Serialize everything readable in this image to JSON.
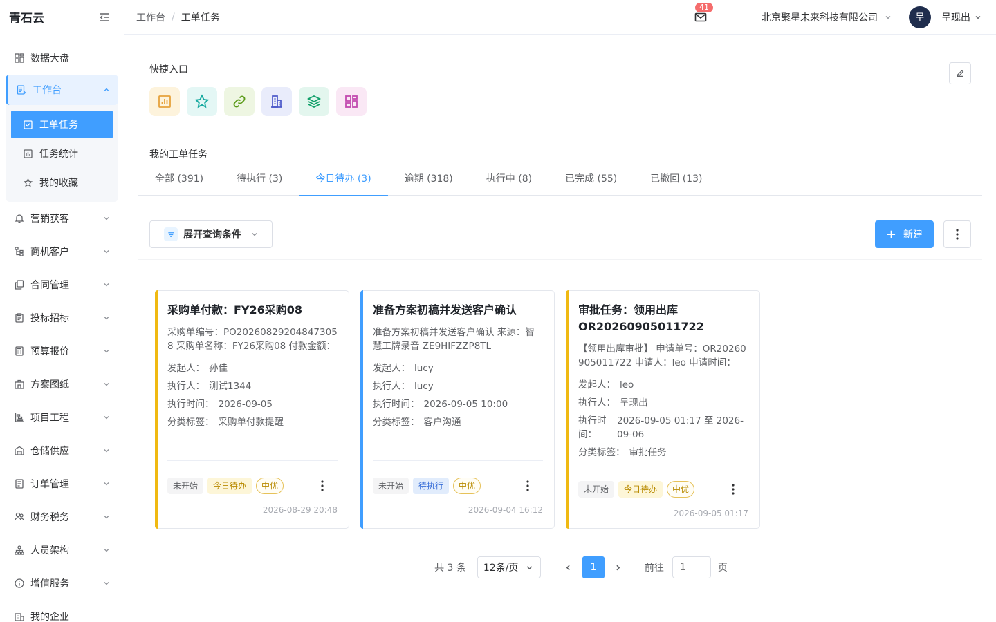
{
  "sidebar": {
    "brand": "青石云",
    "items": [
      {
        "label": "数据大盘",
        "icon": "dashboard-icon"
      },
      {
        "label": "工作台",
        "icon": "workbench-icon",
        "expanded": true,
        "children": [
          {
            "label": "工单任务",
            "icon": "checkbox-icon",
            "active": true
          },
          {
            "label": "任务统计",
            "icon": "bar-chart-icon"
          },
          {
            "label": "我的收藏",
            "icon": "star-icon"
          }
        ]
      },
      {
        "label": "营销获客",
        "icon": "bell-icon"
      },
      {
        "label": "商机客户",
        "icon": "org-tree-icon"
      },
      {
        "label": "合同管理",
        "icon": "copy-icon"
      },
      {
        "label": "投标招标",
        "icon": "clipboard-icon"
      },
      {
        "label": "预算报价",
        "icon": "calculator-icon"
      },
      {
        "label": "方案图纸",
        "icon": "building-icon"
      },
      {
        "label": "项目工程",
        "icon": "gantt-icon"
      },
      {
        "label": "仓储供应",
        "icon": "warehouse-icon"
      },
      {
        "label": "订单管理",
        "icon": "order-icon"
      },
      {
        "label": "财务税务",
        "icon": "finance-icon"
      },
      {
        "label": "人员架构",
        "icon": "people-icon"
      },
      {
        "label": "增值服务",
        "icon": "info-icon"
      },
      {
        "label": "我的企业",
        "icon": "enterprise-icon"
      }
    ]
  },
  "header": {
    "breadcrumb": [
      "工作台",
      "/",
      "工单任务"
    ],
    "mail_badge": "41",
    "company": "北京聚星未来科技有限公司",
    "avatar_text": "呈",
    "username": "呈现出"
  },
  "quick": {
    "title": "快捷入口",
    "icons": [
      {
        "name": "report-icon",
        "bg": "#fdf3dc",
        "color": "#e6a23c"
      },
      {
        "name": "favorite-star-icon",
        "bg": "#e4f7f5",
        "color": "#13a89e"
      },
      {
        "name": "link-icon",
        "bg": "#eef6e2",
        "color": "#5b9b1a"
      },
      {
        "name": "building-icon",
        "bg": "#e9ecfb",
        "color": "#4a57c9"
      },
      {
        "name": "layers-icon",
        "bg": "#e3f6ee",
        "color": "#12a06a"
      },
      {
        "name": "apps-grid-icon",
        "bg": "#fae8f5",
        "color": "#c24ab0"
      }
    ]
  },
  "tasks": {
    "title": "我的工单任务",
    "tabs": [
      "全部 (391)",
      "待执行 (3)",
      "今日待办 (3)",
      "逾期 (318)",
      "执行中 (8)",
      "已完成 (55)",
      "已撤回 (13)"
    ],
    "active_tab": 2,
    "filter_label": "展开查询条件",
    "new_label": "新建"
  },
  "cards": [
    {
      "accent": "yellow",
      "title": "采购单付款：FY26采购08",
      "desc": "采购单编号：PO202608292048473058 采购单名称：FY26采购08 付款金额：",
      "initiator_label": "发起人：",
      "initiator": "孙佳",
      "executor_label": "执行人：",
      "executor": "测试1344",
      "time_label": "执行时间：",
      "time": "2026-09-05",
      "category_label": "分类标签：",
      "category": "采购单付款提醒",
      "tags": [
        "未开始",
        "今日待办",
        "中优"
      ],
      "created": "2026-08-29 20:48"
    },
    {
      "accent": "blue",
      "title": "准备方案初稿并发送客户确认",
      "desc": "准备方案初稿并发送客户确认 来源：智慧工牌录音 ZE9HIFZZP8TL",
      "initiator_label": "发起人：",
      "initiator": "lucy",
      "executor_label": "执行人：",
      "executor": "lucy",
      "time_label": "执行时间：",
      "time": "2026-09-05 10:00",
      "category_label": "分类标签：",
      "category": "客户沟通",
      "tags": [
        "未开始",
        "待执行",
        "中优"
      ],
      "created": "2026-09-04 16:12"
    },
    {
      "accent": "yellow",
      "title": "审批任务：领用出库 OR20260905011722",
      "desc": "【领用出库审批】 申请单号：OR20260905011722 申请人：leo 申请时间：",
      "initiator_label": "发起人：",
      "initiator": "leo",
      "executor_label": "执行人：",
      "executor": "呈现出",
      "time_label": "执行时间：",
      "time": "2026-09-05 01:17 至 2026-09-06",
      "category_label": "分类标签：",
      "category": "审批任务",
      "tags": [
        "未开始",
        "今日待办",
        "中优"
      ],
      "created": "2026-09-05 01:17"
    }
  ],
  "pager": {
    "total": "共 3 条",
    "size": "12条/页",
    "current": "1",
    "goto": "前往",
    "goto_placeholder": "1",
    "page_unit": "页"
  }
}
